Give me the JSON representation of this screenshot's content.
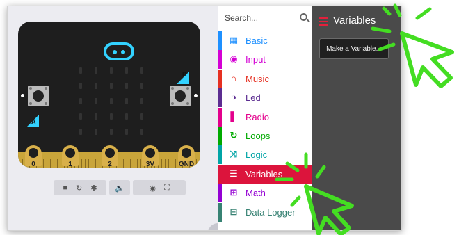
{
  "simulator": {
    "button_a_label": "A",
    "button_b_label": "B",
    "pins": [
      "0",
      "1",
      "2",
      "3V",
      "GND"
    ],
    "controls": [
      "stop-icon",
      "restart-icon",
      "debug-icon",
      "sound-icon",
      "screenshot-icon",
      "fullscreen-icon"
    ]
  },
  "toolbox": {
    "search_placeholder": "Search...",
    "categories": [
      {
        "label": "Basic",
        "color": "#1e90ff",
        "icon": "grid-icon"
      },
      {
        "label": "Input",
        "color": "#d400d4",
        "icon": "target-icon"
      },
      {
        "label": "Music",
        "color": "#e63022",
        "icon": "headphones-icon"
      },
      {
        "label": "Led",
        "color": "#5c2d91",
        "icon": "toggle-icon"
      },
      {
        "label": "Radio",
        "color": "#e3008c",
        "icon": "signal-icon"
      },
      {
        "label": "Loops",
        "color": "#00aa00",
        "icon": "loop-icon"
      },
      {
        "label": "Logic",
        "color": "#00a4a6",
        "icon": "shuffle-icon"
      },
      {
        "label": "Variables",
        "color": "#dc143c",
        "icon": "list-icon"
      },
      {
        "label": "Math",
        "color": "#9400d3",
        "icon": "calculator-icon"
      },
      {
        "label": "Data Logger",
        "color": "#378273",
        "icon": "table-icon"
      }
    ]
  },
  "flyout": {
    "title": "Variables",
    "make_variable_label": "Make a Variable...",
    "accent": "#dc143c"
  },
  "annotations": {
    "cursor_color": "#44dd22"
  }
}
